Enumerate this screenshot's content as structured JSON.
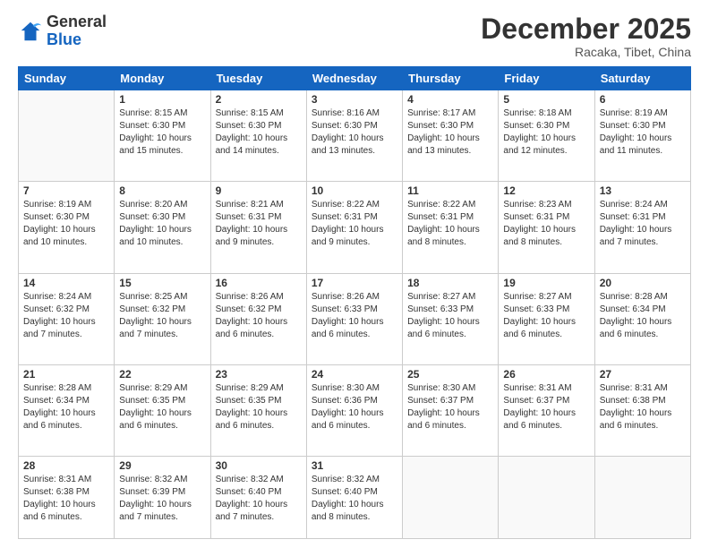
{
  "logo": {
    "general": "General",
    "blue": "Blue"
  },
  "header": {
    "month_title": "December 2025",
    "location": "Racaka, Tibet, China"
  },
  "days_of_week": [
    "Sunday",
    "Monday",
    "Tuesday",
    "Wednesday",
    "Thursday",
    "Friday",
    "Saturday"
  ],
  "weeks": [
    [
      {
        "day": "",
        "info": ""
      },
      {
        "day": "1",
        "info": "Sunrise: 8:15 AM\nSunset: 6:30 PM\nDaylight: 10 hours\nand 15 minutes."
      },
      {
        "day": "2",
        "info": "Sunrise: 8:15 AM\nSunset: 6:30 PM\nDaylight: 10 hours\nand 14 minutes."
      },
      {
        "day": "3",
        "info": "Sunrise: 8:16 AM\nSunset: 6:30 PM\nDaylight: 10 hours\nand 13 minutes."
      },
      {
        "day": "4",
        "info": "Sunrise: 8:17 AM\nSunset: 6:30 PM\nDaylight: 10 hours\nand 13 minutes."
      },
      {
        "day": "5",
        "info": "Sunrise: 8:18 AM\nSunset: 6:30 PM\nDaylight: 10 hours\nand 12 minutes."
      },
      {
        "day": "6",
        "info": "Sunrise: 8:19 AM\nSunset: 6:30 PM\nDaylight: 10 hours\nand 11 minutes."
      }
    ],
    [
      {
        "day": "7",
        "info": "Sunrise: 8:19 AM\nSunset: 6:30 PM\nDaylight: 10 hours\nand 10 minutes."
      },
      {
        "day": "8",
        "info": "Sunrise: 8:20 AM\nSunset: 6:30 PM\nDaylight: 10 hours\nand 10 minutes."
      },
      {
        "day": "9",
        "info": "Sunrise: 8:21 AM\nSunset: 6:31 PM\nDaylight: 10 hours\nand 9 minutes."
      },
      {
        "day": "10",
        "info": "Sunrise: 8:22 AM\nSunset: 6:31 PM\nDaylight: 10 hours\nand 9 minutes."
      },
      {
        "day": "11",
        "info": "Sunrise: 8:22 AM\nSunset: 6:31 PM\nDaylight: 10 hours\nand 8 minutes."
      },
      {
        "day": "12",
        "info": "Sunrise: 8:23 AM\nSunset: 6:31 PM\nDaylight: 10 hours\nand 8 minutes."
      },
      {
        "day": "13",
        "info": "Sunrise: 8:24 AM\nSunset: 6:31 PM\nDaylight: 10 hours\nand 7 minutes."
      }
    ],
    [
      {
        "day": "14",
        "info": "Sunrise: 8:24 AM\nSunset: 6:32 PM\nDaylight: 10 hours\nand 7 minutes."
      },
      {
        "day": "15",
        "info": "Sunrise: 8:25 AM\nSunset: 6:32 PM\nDaylight: 10 hours\nand 7 minutes."
      },
      {
        "day": "16",
        "info": "Sunrise: 8:26 AM\nSunset: 6:32 PM\nDaylight: 10 hours\nand 6 minutes."
      },
      {
        "day": "17",
        "info": "Sunrise: 8:26 AM\nSunset: 6:33 PM\nDaylight: 10 hours\nand 6 minutes."
      },
      {
        "day": "18",
        "info": "Sunrise: 8:27 AM\nSunset: 6:33 PM\nDaylight: 10 hours\nand 6 minutes."
      },
      {
        "day": "19",
        "info": "Sunrise: 8:27 AM\nSunset: 6:33 PM\nDaylight: 10 hours\nand 6 minutes."
      },
      {
        "day": "20",
        "info": "Sunrise: 8:28 AM\nSunset: 6:34 PM\nDaylight: 10 hours\nand 6 minutes."
      }
    ],
    [
      {
        "day": "21",
        "info": "Sunrise: 8:28 AM\nSunset: 6:34 PM\nDaylight: 10 hours\nand 6 minutes."
      },
      {
        "day": "22",
        "info": "Sunrise: 8:29 AM\nSunset: 6:35 PM\nDaylight: 10 hours\nand 6 minutes."
      },
      {
        "day": "23",
        "info": "Sunrise: 8:29 AM\nSunset: 6:35 PM\nDaylight: 10 hours\nand 6 minutes."
      },
      {
        "day": "24",
        "info": "Sunrise: 8:30 AM\nSunset: 6:36 PM\nDaylight: 10 hours\nand 6 minutes."
      },
      {
        "day": "25",
        "info": "Sunrise: 8:30 AM\nSunset: 6:37 PM\nDaylight: 10 hours\nand 6 minutes."
      },
      {
        "day": "26",
        "info": "Sunrise: 8:31 AM\nSunset: 6:37 PM\nDaylight: 10 hours\nand 6 minutes."
      },
      {
        "day": "27",
        "info": "Sunrise: 8:31 AM\nSunset: 6:38 PM\nDaylight: 10 hours\nand 6 minutes."
      }
    ],
    [
      {
        "day": "28",
        "info": "Sunrise: 8:31 AM\nSunset: 6:38 PM\nDaylight: 10 hours\nand 6 minutes."
      },
      {
        "day": "29",
        "info": "Sunrise: 8:32 AM\nSunset: 6:39 PM\nDaylight: 10 hours\nand 7 minutes."
      },
      {
        "day": "30",
        "info": "Sunrise: 8:32 AM\nSunset: 6:40 PM\nDaylight: 10 hours\nand 7 minutes."
      },
      {
        "day": "31",
        "info": "Sunrise: 8:32 AM\nSunset: 6:40 PM\nDaylight: 10 hours\nand 8 minutes."
      },
      {
        "day": "",
        "info": ""
      },
      {
        "day": "",
        "info": ""
      },
      {
        "day": "",
        "info": ""
      }
    ]
  ]
}
